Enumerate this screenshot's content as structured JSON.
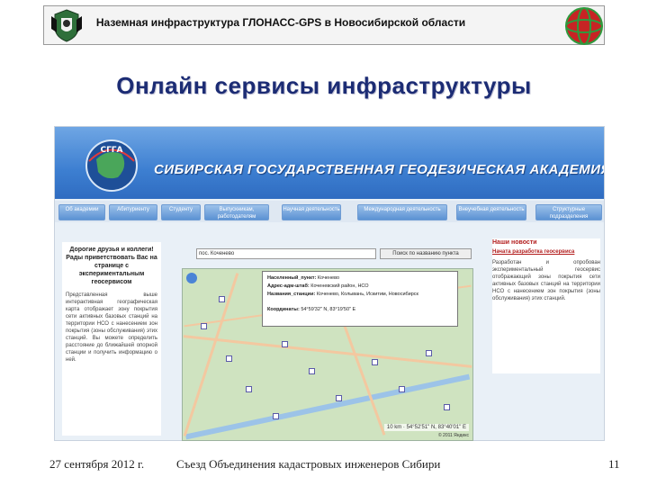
{
  "header": {
    "title": "Наземная инфраструктура ГЛОНАСС-GPS  в Новосибирской области"
  },
  "slide_title": "Онлайн сервисы инфраструктуры",
  "site": {
    "banner_text": "СИБИРСКАЯ ГОСУДАРСТВЕННАЯ ГЕОДЕЗИЧЕСКАЯ АКАДЕМИЯ",
    "logo_text": "СГГА",
    "nav_items": [
      "Об академии",
      "Абитуриенту",
      "Студенту",
      "Выпускникам, работодателям",
      "Научная деятельность",
      "Международная деятельность",
      "Внеучебная деятельность",
      "Структурные подразделения"
    ],
    "left_panel": {
      "title": "Дорогие друзья и коллеги! Рады приветствовать Вас на странице с экспериментальным геосервисом",
      "text": "Представленная выше интерактивная географическая карта отображает зону покрытия сети активных базовых станций на территории НСО с нанесением зон покрытия (зоны обслуживания) этих станций. Вы можете определить расстояние до ближайшей опорной станции и получить информацию о ней."
    },
    "search": {
      "value": "пос. Коченево",
      "button_label": "Поиск по названию пункта"
    },
    "popup": {
      "name_label": "Населенный_пункт:",
      "name_value": "Коченево",
      "address_label": "Адрес-адм-штаб:",
      "address_value": "Коченевский район, НСО",
      "station_label": "Названия_станции:",
      "station_value": "Коченево, Колывань, Искитим, Новосибирск",
      "coords_label": "Координаты:",
      "coords_value": "54°59'32\" N, 83°19'50\" E"
    },
    "map_scale": "10 km",
    "map_coords": "54°52'51\" N, 83°40'01\" E",
    "map_copyright": "© 2011 Яндекс",
    "news": {
      "head": "Наши новости",
      "link": "Начата разработка геосервиса",
      "text": "Разработан и опробован экспериментальный геосервис отображающий зоны покрытия сети активных базовых станций на территории НСО с нанесением зон покрытия (зоны обслуживания) этих станций."
    }
  },
  "footer": {
    "date": "27 сентября 2012 г.",
    "center": "Съезд Объединения кадастровых инженеров Сибири",
    "page": "11"
  },
  "colors": {
    "title": "#1c2c74",
    "banner": "#3d7fd1"
  }
}
